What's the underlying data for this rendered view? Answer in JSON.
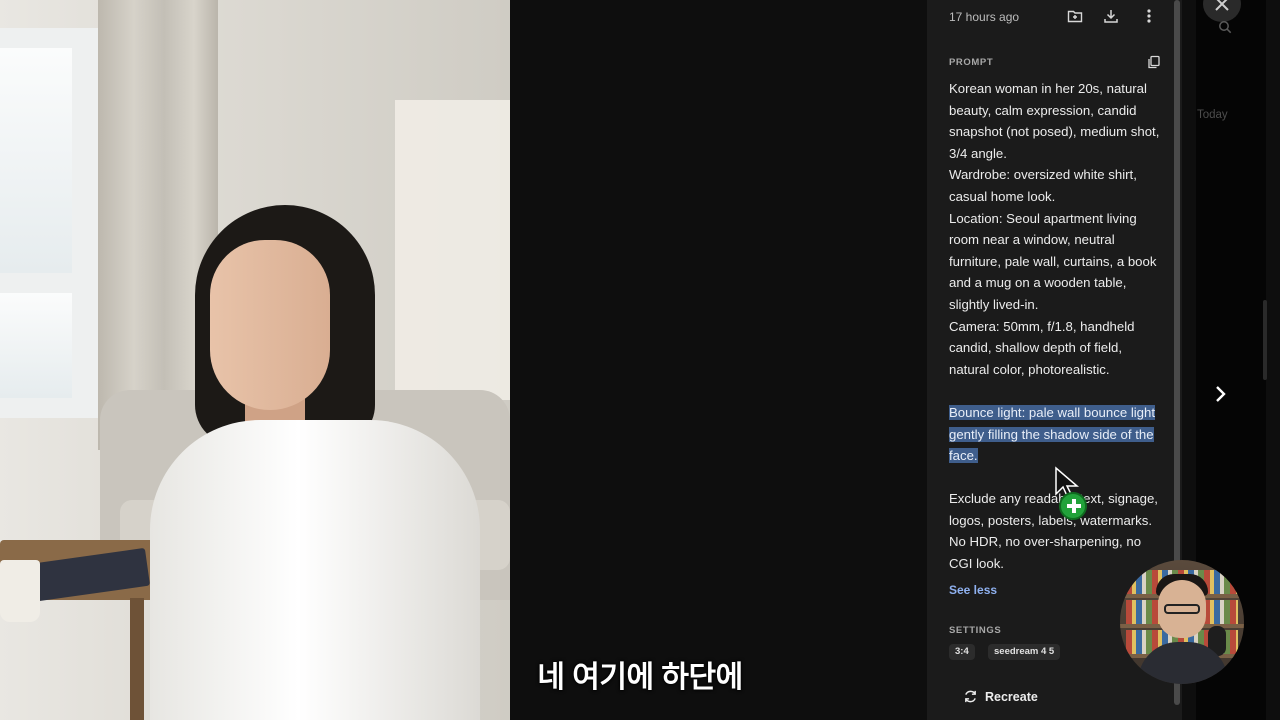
{
  "image_panel": {
    "description_icon": "generated-photo"
  },
  "caption": {
    "text": "네 여기에 하단에"
  },
  "details": {
    "timestamp": "17 hours ago",
    "icons": [
      "folder-plus-icon",
      "download-icon",
      "more-vertical-icon",
      "copy-icon"
    ],
    "prompt_label": "PROMPT",
    "prompt_paragraphs": [
      "Korean woman in her 20s, natural beauty, calm expression, candid snapshot (not posed), medium shot, 3/4 angle.",
      "Wardrobe: oversized white shirt, casual home look.",
      "Location: Seoul apartment living room near a window, neutral furniture, pale wall, curtains, a book and a mug on a wooden table, slightly lived-in.",
      "Camera: 50mm, f/1.8, handheld candid, shallow depth of field, natural color, photorealistic."
    ],
    "highlighted_paragraph": "Bounce light: pale wall bounce light gently filling the shadow side of the face.",
    "exclude_paragraph": "Exclude any readable text, signage, logos, posters, labels, watermarks. No HDR, no over-sharpening, no CGI look.",
    "see_less": "See less",
    "settings_label": "SETTINGS",
    "settings_chips": [
      "3:4",
      "seedream 4 5"
    ],
    "recreate_label": "Recreate"
  },
  "sidebar": {
    "today_label": "Today"
  }
}
